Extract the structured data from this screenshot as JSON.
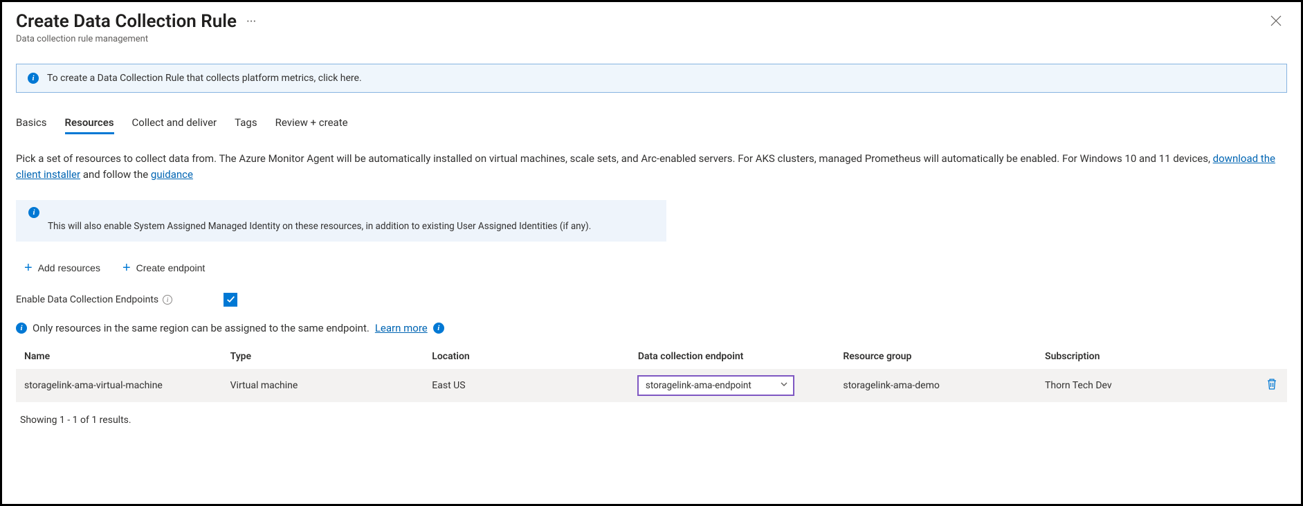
{
  "header": {
    "title": "Create Data Collection Rule",
    "subtitle": "Data collection rule management"
  },
  "infoBox1": "To create a Data Collection Rule that collects platform metrics, click here.",
  "tabs": [
    {
      "label": "Basics",
      "active": false
    },
    {
      "label": "Resources",
      "active": true
    },
    {
      "label": "Collect and deliver",
      "active": false
    },
    {
      "label": "Tags",
      "active": false
    },
    {
      "label": "Review + create",
      "active": false
    }
  ],
  "description": {
    "part1": "Pick a set of resources to collect data from. The Azure Monitor Agent will be automatically installed on virtual machines, scale sets, and Arc-enabled servers. For AKS clusters, managed Prometheus will automatically be enabled. For Windows 10 and 11 devices, ",
    "link1": "download the client installer",
    "part2": " and follow the ",
    "link2": "guidance"
  },
  "infoBox2": "This will also enable System Assigned Managed Identity on these resources, in addition to existing User Assigned Identities (if any).",
  "actions": {
    "addResources": "Add resources",
    "createEndpoint": "Create endpoint"
  },
  "enableDce": {
    "label": "Enable Data Collection Endpoints",
    "checked": true
  },
  "regionNote": {
    "text": "Only resources in the same region can be assigned to the same endpoint.",
    "learnMore": "Learn more"
  },
  "table": {
    "headers": {
      "name": "Name",
      "type": "Type",
      "location": "Location",
      "dce": "Data collection endpoint",
      "rg": "Resource group",
      "sub": "Subscription"
    },
    "rows": [
      {
        "name": "storagelink-ama-virtual-machine",
        "type": "Virtual machine",
        "location": "East US",
        "dce": "storagelink-ama-endpoint",
        "rg": "storagelink-ama-demo",
        "sub": "Thorn Tech Dev"
      }
    ]
  },
  "resultsLabel": "Showing 1 - 1 of 1 results."
}
